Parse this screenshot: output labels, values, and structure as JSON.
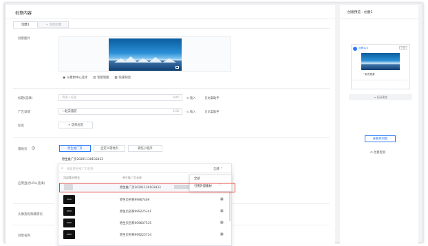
{
  "section_title": "创意内容",
  "tabs": {
    "active": "创意1",
    "add": "+ 添加创意"
  },
  "image": {
    "label": "创意图片",
    "actions": [
      "从素材中心选择",
      "智能制图",
      "快速制图"
    ]
  },
  "headline": {
    "label": "标题(选填)",
    "placeholder": "请输入标题",
    "count": "0/40",
    "emoji": "⊙ 插入",
    "wildcard": "[]文案助手"
  },
  "ad_copy": {
    "label": "广告详情",
    "value": "一起去旅游",
    "count": "5/30",
    "emoji": "⊙ 插入",
    "wildcard": "[]文案助手"
  },
  "tags": {
    "label": "标签",
    "button": "+ 选择标签"
  },
  "landing": {
    "label": "落地页",
    "options": [
      "原生推广页",
      "自定义落地页",
      "微信小程序"
    ],
    "selected_value": "原生推广页20201130103433"
  },
  "dropdown": {
    "search_placeholder": "搜索原生推广页名称",
    "filter": "全部",
    "header_preview": "顶部素材预览",
    "header_name": "原生推广页名称",
    "rows": [
      {
        "name": "原生推广页20201130103433",
        "highlight": true
      },
      {
        "name": "原生页名称99967469"
      },
      {
        "name": "原生页名称999225341"
      },
      {
        "name": "原生页名称999607535"
      },
      {
        "name": "原生页名称999225734"
      }
    ],
    "menu": [
      "全部",
      "引用外部素材"
    ]
  },
  "side_labels": {
    "app_url": "应用直达URL(选填)",
    "avatar": "头像及昵称跳转页",
    "brand": "创意名称"
  },
  "preview": {
    "title": "创意预览 - 创意1",
    "brand_name": "品牌123",
    "ad_label": "广告",
    "caption": "一起去旅游",
    "more_preview": "↔ 扫码预览",
    "button": "查看原创图",
    "check": "⊙ 创意检测"
  }
}
